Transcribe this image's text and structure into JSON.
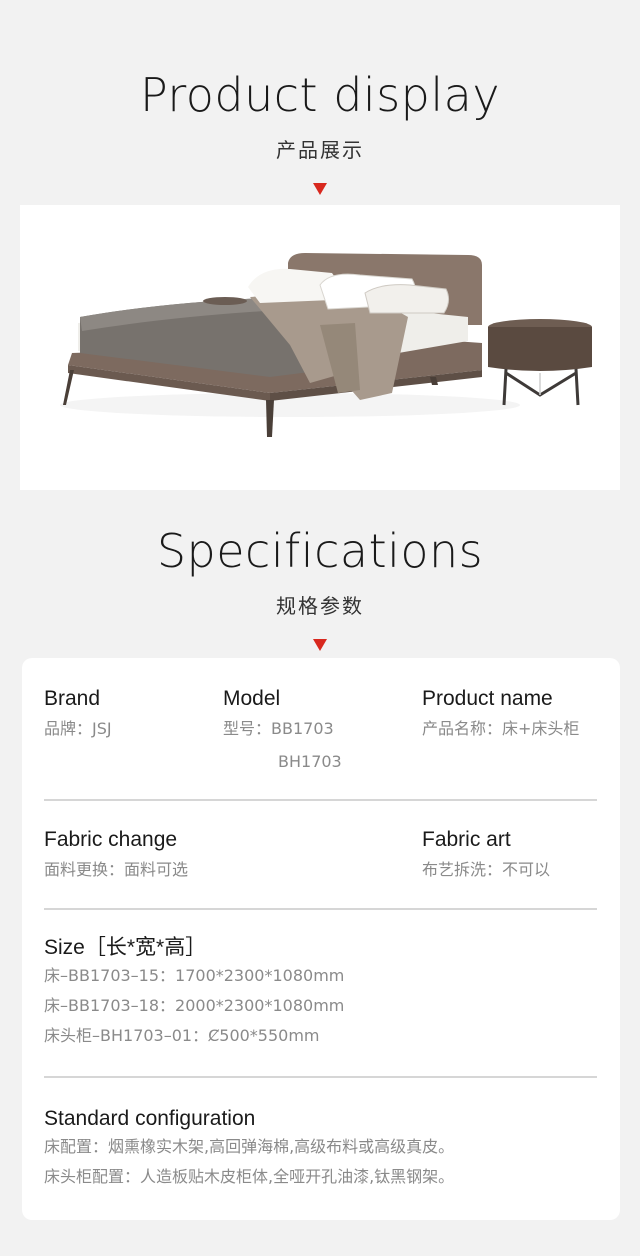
{
  "product_display": {
    "title_en": "Product display",
    "title_cn": "产品展示"
  },
  "specifications": {
    "title_en": "Specifications",
    "title_cn": "规格参数"
  },
  "specs": {
    "brand": {
      "label": "Brand",
      "value": "品牌：JSJ"
    },
    "model": {
      "label": "Model",
      "value": "型号：BB1703",
      "value2": "BH1703"
    },
    "product_name": {
      "label": "Product name",
      "value": "产品名称：床+床头柜"
    },
    "fabric_change": {
      "label": "Fabric change",
      "value": "面料更换：面料可选"
    },
    "fabric_art": {
      "label": "Fabric art",
      "value": "布艺拆洗：不可以"
    },
    "size": {
      "label": "Size［长*宽*高］",
      "lines": [
        "床–BB1703–15：1700*2300*1080mm",
        "床–BB1703–18：2000*2300*1080mm",
        "床头柜–BH1703–01：Ȼ500*550mm"
      ]
    },
    "standard": {
      "label": "Standard configuration",
      "lines": [
        "床配置：烟熏橡实木架,高回弹海棉,高级布料或高级真皮。",
        "床头柜配置：人造板贴木皮柜体,全哑开孔油漆,钛黑钢架。"
      ]
    }
  },
  "colors": {
    "accent": "#d8281e",
    "background": "#f2f2f2",
    "card": "#ffffff"
  }
}
